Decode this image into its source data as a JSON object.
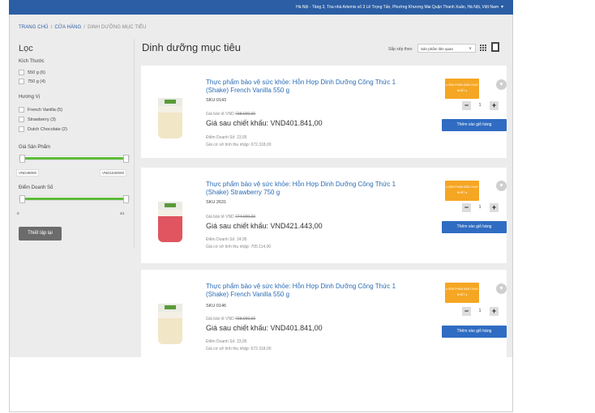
{
  "topbar": {
    "address": "Hà Nội - Tầng 3, Tòa nhà Artemis số 3 Lê Trọng Tấn, Phường Khương Mai Quận Thanh Xuân, Hà Nội, Việt Nam",
    "caret": "▾"
  },
  "breadcrumb": {
    "home": "TRANG CHỦ",
    "sep": "/",
    "shop": "CỬA HÀNG",
    "current": "DINH DƯỠNG MỤC TIÊU"
  },
  "sidebar": {
    "title": "Lọc",
    "size_heading": "Kích Thước",
    "sizes": [
      {
        "label": "550 g (6)"
      },
      {
        "label": "750 g (4)"
      }
    ],
    "flavor_heading": "Hương Vị",
    "flavors": [
      {
        "label": "French Vanilla (5)"
      },
      {
        "label": "Strawberry (3)"
      },
      {
        "label": "Dutch Chocolate (2)"
      }
    ],
    "price_heading": "Giá Sản Phẩm",
    "price_min": "VND48000",
    "price_max": "VND1530000",
    "points_heading": "Điểm Doanh Số",
    "points_min": "0",
    "points_max": "44",
    "reset_label": "Thiết lập lại"
  },
  "main": {
    "title": "Dinh dưỡng mục tiêu",
    "sort_label": "Sắp xếp theo",
    "sort_value": "Sản phẩm liên quan",
    "sort_caret": "∨"
  },
  "products": [
    {
      "name": "Thực phẩm bảo vệ sức khỏe: Hỗn Hợp Dinh Dưỡng Công Thức 1 (Shake) French Vanilla 550 g",
      "sku": "SKU 0143",
      "retail_label": "Giá bán lẻ VND",
      "retail_price": "738.000,00",
      "discount": "Giá sau chiết khấu: VND401.841,00",
      "points": "Điểm Doanh Số: 23,95",
      "base": "Giá cơ sở tính thu nhập: 672.318,00",
      "badge_l1": "● SẢN PHẨM BÁN CHẠY",
      "badge_l2": "NHẤT ●",
      "qty": "1",
      "minus": "−",
      "plus": "+",
      "cart": "Thêm vào giỏ hàng",
      "heart": "♥",
      "label_color": "#f1e6c6"
    },
    {
      "name": "Thực phẩm bảo vệ sức khỏe: Hỗn Hợp Dinh Dưỡng Công Thức 1 (Shake) Strawberry 750 g",
      "sku": "SKU 2631",
      "retail_label": "Giá bán lẻ VND",
      "retail_price": "774.000,00",
      "discount": "Giá sau chiết khấu: VND421.443,00",
      "points": "Điểm Doanh Số: 24,95",
      "base": "Giá cơ sở tính thu nhập: 705.114,00",
      "badge_l1": "● SẢN PHẨM BÁN CHẠY",
      "badge_l2": "NHẤT ●",
      "qty": "1",
      "minus": "−",
      "plus": "+",
      "cart": "Thêm vào giỏ hàng",
      "heart": "♥",
      "label_color": "#e0555f"
    },
    {
      "name": "Thực phẩm bảo vệ sức khỏe: Hỗn Hợp Dinh Dưỡng Công Thức 1 (Shake) French Vanilla 550 g",
      "sku": "SKU 0146",
      "retail_label": "Giá bán lẻ VND",
      "retail_price": "738.000,00",
      "discount": "Giá sau chiết khấu: VND401.841,00",
      "points": "Điểm Doanh Số: 23,95",
      "base": "Giá cơ sở tính thu nhập: 672.318,00",
      "badge_l1": "● SẢN PHẨM BÁN CHẠY",
      "badge_l2": "NHẤT ●",
      "qty": "1",
      "minus": "−",
      "plus": "+",
      "cart": "Thêm vào giỏ hàng",
      "heart": "♥",
      "label_color": "#f1e6c6"
    }
  ]
}
